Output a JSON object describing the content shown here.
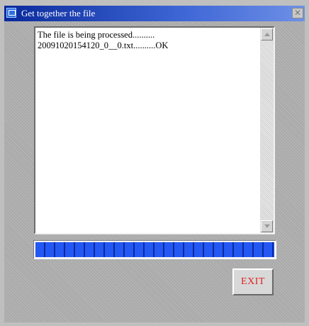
{
  "window": {
    "title": "Get together the file",
    "close_glyph": "✕",
    "title_icon": "window-icon"
  },
  "log": {
    "lines": [
      "The file is being processed..........",
      "20091020154120_0__0.txt..........OK"
    ]
  },
  "progress": {
    "percent": 100
  },
  "buttons": {
    "exit_label": "EXIT"
  },
  "colors": {
    "titlebar": "#0a2a9c",
    "progress": "#1747d6",
    "exit_text": "#e02020"
  }
}
